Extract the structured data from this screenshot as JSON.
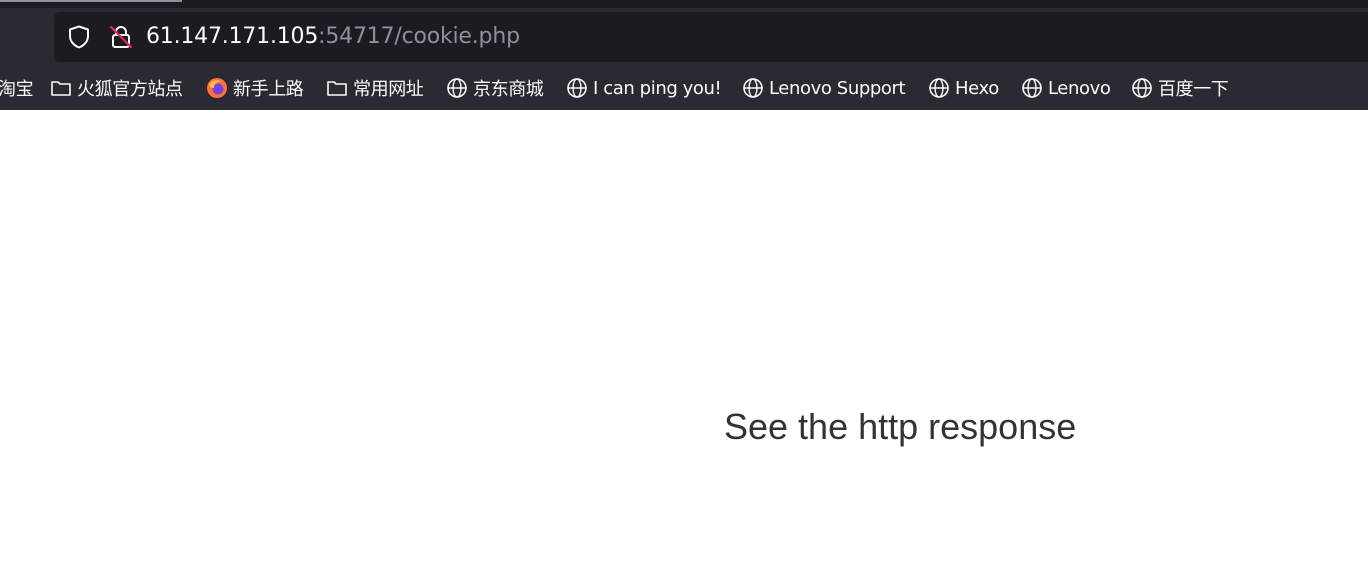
{
  "urlbar": {
    "host": "61.147.171.105",
    "rest": ":54717/cookie.php"
  },
  "bookmarks": [
    {
      "label": "淘宝",
      "icon": "none"
    },
    {
      "label": "火狐官方站点",
      "icon": "folder-icon"
    },
    {
      "label": "新手上路",
      "icon": "firefox-icon"
    },
    {
      "label": "常用网址",
      "icon": "folder-icon"
    },
    {
      "label": "京东商城",
      "icon": "globe-icon"
    },
    {
      "label": "I can ping you!",
      "icon": "globe-icon"
    },
    {
      "label": "Lenovo Support",
      "icon": "globe-icon"
    },
    {
      "label": "Hexo",
      "icon": "globe-icon"
    },
    {
      "label": "Lenovo",
      "icon": "globe-icon"
    },
    {
      "label": "百度一下",
      "icon": "globe-icon"
    }
  ],
  "page": {
    "message": "See the http response"
  },
  "colors": {
    "toolbar": "#2b2a33",
    "urlbar": "#1c1b22",
    "text_light": "#fbfbfe",
    "text_dim": "#8f8f9d",
    "page_text": "#333333"
  }
}
